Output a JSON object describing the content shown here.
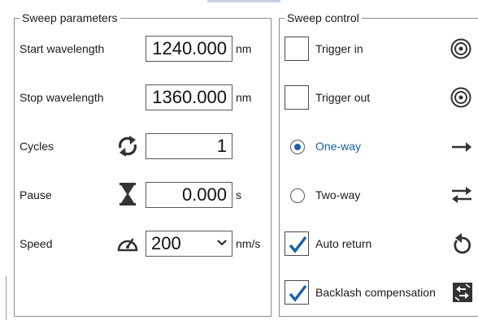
{
  "sweep_parameters": {
    "title": "Sweep parameters",
    "start_wavelength": {
      "label": "Start wavelength",
      "value": "1240.000",
      "unit": "nm"
    },
    "stop_wavelength": {
      "label": "Stop wavelength",
      "value": "1360.000",
      "unit": "nm"
    },
    "cycles": {
      "label": "Cycles",
      "value": "1",
      "icon": "repeat-icon"
    },
    "pause": {
      "label": "Pause",
      "value": "0.000",
      "unit": "s",
      "icon": "hourglass-icon"
    },
    "speed": {
      "label": "Speed",
      "value": "200",
      "unit": "nm/s",
      "icon": "speedometer-icon"
    }
  },
  "sweep_control": {
    "title": "Sweep control",
    "trigger_in": {
      "label": "Trigger in",
      "checked": false,
      "icon": "trigger-target-icon"
    },
    "trigger_out": {
      "label": "Trigger out",
      "checked": false,
      "icon": "trigger-target-icon"
    },
    "mode": {
      "selected": "One-way",
      "options": [
        {
          "label": "One-way",
          "selected": true,
          "icon": "arrow-right-icon"
        },
        {
          "label": "Two-way",
          "selected": false,
          "icon": "arrows-swap-icon"
        }
      ]
    },
    "auto_return": {
      "label": "Auto return",
      "checked": true,
      "icon": "return-arrow-icon"
    },
    "backlash_compensation": {
      "label": "Backlash compensation",
      "checked": true,
      "icon": "backlash-icon"
    }
  },
  "colors": {
    "accent": "#1a5fa8",
    "border": "#8c8c8c",
    "text": "#1a1a1a"
  }
}
